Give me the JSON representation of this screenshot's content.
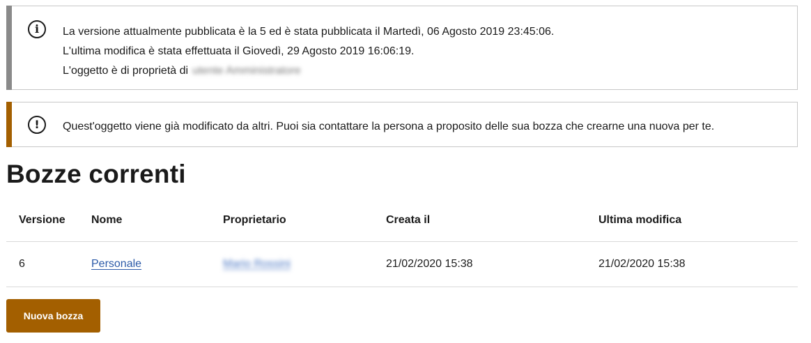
{
  "info_notice": {
    "icon": "info-icon",
    "line1": "La versione attualmente pubblicata è la 5 ed è stata pubblicata il Martedì, 06 Agosto 2019 23:45:06.",
    "line2": "L'ultima modifica è stata effettuata il Giovedì, 29 Agosto 2019 16:06:19.",
    "line3_prefix": "L'oggetto è di proprietà di",
    "owner_blurred": "utente Amministratore"
  },
  "warning_notice": {
    "icon": "exclamation-icon",
    "text": "Quest'oggetto viene già modificato da altri. Puoi sia contattare la persona a proposito delle sua bozza che crearne una nuova per te."
  },
  "page_title": "Bozze correnti",
  "table": {
    "headers": [
      "Versione",
      "Nome",
      "Proprietario",
      "Creata il",
      "Ultima modifica"
    ],
    "rows": [
      {
        "version": "6",
        "name": "Personale",
        "owner": "Mario Rossini",
        "created": "21/02/2020 15:38",
        "modified": "21/02/2020 15:38"
      }
    ]
  },
  "new_draft_button": "Nuova bozza",
  "colors": {
    "accent": "#a35f00",
    "info_stripe": "#8a8a8a",
    "link": "#2b5aa8"
  }
}
